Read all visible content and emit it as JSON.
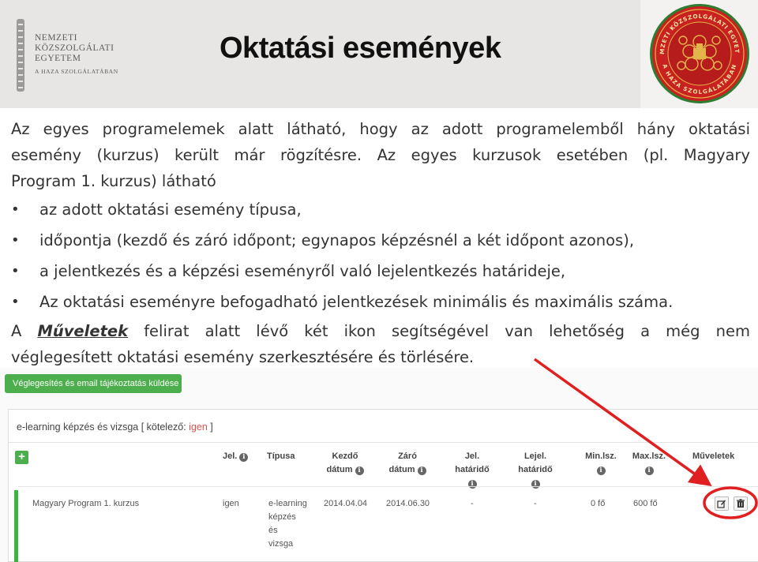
{
  "header": {
    "logo_lines": [
      "NEMZETI",
      "KÖZSZOLGÁLATI",
      "EGYETEM"
    ],
    "logo_tagline": "A HAZA SZOLGÁLATÁBAN",
    "title": "Oktatási események",
    "seal_text_top": "NEMZETI KÖZSZOLGÁLATI EGYETEM",
    "seal_text_bottom": "A HAZA SZOLGÁLATÁBAN"
  },
  "intro": {
    "line1": "Az egyes programelemek alatt látható, hogy az adott programelemből hány oktatási",
    "line2": "esemény (kurzus) került már rögzítésre. Az egyes kurzusok esetében (pl. Magyary",
    "line3": "Program 1. kurzus) látható"
  },
  "bullets": [
    "az adott oktatási esemény típusa,",
    "időpontja (kezdő és záró időpont; egynapos képzésnél a két időpont azonos),",
    "a jelentkezés és a képzési eseményről való lejelentkezés határideje,",
    "Az oktatási eseményre befogadható jelentkezések minimális és maximális száma."
  ],
  "outro": {
    "pre": "A ",
    "emphasis": "Műveletek",
    "post": " felirat alatt lévő két ikon segítségével van lehetőség a még nem",
    "line2": "véglegesített oktatási esemény szerkesztésére és törlésére."
  },
  "screenshot": {
    "finalize_button": "Véglegesítés és email tájékoztatás küldése",
    "panel_title": "e-learning képzés és vizsga [ kötelező: ",
    "panel_required": "igen",
    "panel_title_end": " ]",
    "add_button": "+",
    "columns": {
      "jel": "Jel.",
      "tipusa": "Típusa",
      "kezdo_1": "Kezdő",
      "kezdo_2": "dátum",
      "zaro_1": "Záró",
      "zaro_2": "dátum",
      "jel_hat_1": "Jel.",
      "jel_hat_2": "határidő",
      "lejel_1": "Lejel.",
      "lejel_2": "határidő",
      "min": "Min.lsz.",
      "max": "Max.lsz.",
      "muveletek": "Műveletek"
    },
    "row": {
      "name": "Magyary Program 1. kurzus",
      "jel": "igen",
      "tipus_lines": [
        "e-learning",
        "képzés",
        "és",
        "vizsga"
      ],
      "kezdo": "2014.04.04",
      "zaro": "2014.06.30",
      "jel_hat": "-",
      "lejel_hat": "-",
      "min": "0 fő",
      "max": "600 fő"
    },
    "edit_icon": "edit-icon",
    "delete_icon": "trash-icon"
  },
  "colors": {
    "header_bg": "#e7e6e4",
    "green": "#4cae4c",
    "annotation_red": "#e02020",
    "seal_red": "#c8211f"
  }
}
